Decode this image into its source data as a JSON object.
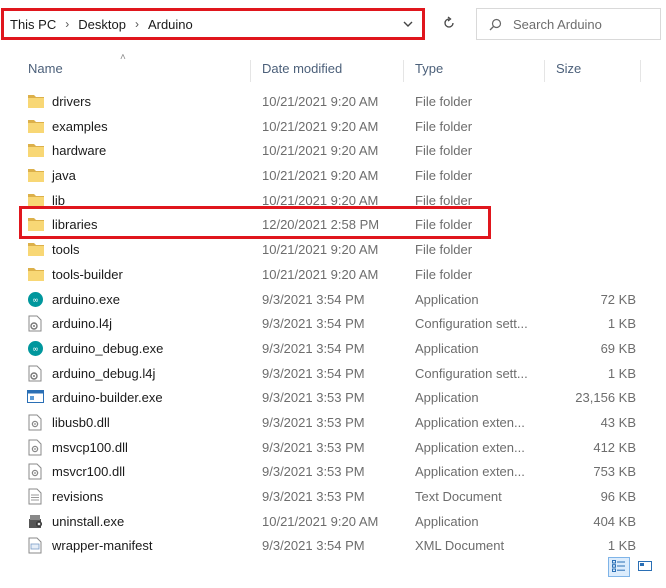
{
  "address": {
    "crumbs": [
      "This PC",
      "Desktop",
      "Arduino"
    ]
  },
  "search": {
    "placeholder": "Search Arduino"
  },
  "columns": {
    "name": "Name",
    "date": "Date modified",
    "type": "Type",
    "size": "Size"
  },
  "files": [
    {
      "name": "drivers",
      "date": "10/21/2021 9:20 AM",
      "type": "File folder",
      "size": "",
      "icon": "folder-icon"
    },
    {
      "name": "examples",
      "date": "10/21/2021 9:20 AM",
      "type": "File folder",
      "size": "",
      "icon": "folder-icon"
    },
    {
      "name": "hardware",
      "date": "10/21/2021 9:20 AM",
      "type": "File folder",
      "size": "",
      "icon": "folder-icon"
    },
    {
      "name": "java",
      "date": "10/21/2021 9:20 AM",
      "type": "File folder",
      "size": "",
      "icon": "folder-icon"
    },
    {
      "name": "lib",
      "date": "10/21/2021 9:20 AM",
      "type": "File folder",
      "size": "",
      "icon": "folder-icon"
    },
    {
      "name": "libraries",
      "date": "12/20/2021 2:58 PM",
      "type": "File folder",
      "size": "",
      "icon": "folder-icon"
    },
    {
      "name": "tools",
      "date": "10/21/2021 9:20 AM",
      "type": "File folder",
      "size": "",
      "icon": "folder-icon"
    },
    {
      "name": "tools-builder",
      "date": "10/21/2021 9:20 AM",
      "type": "File folder",
      "size": "",
      "icon": "folder-icon"
    },
    {
      "name": "arduino.exe",
      "date": "9/3/2021 3:54 PM",
      "type": "Application",
      "size": "72 KB",
      "icon": "arduino-icon"
    },
    {
      "name": "arduino.l4j",
      "date": "9/3/2021 3:54 PM",
      "type": "Configuration sett...",
      "size": "1 KB",
      "icon": "config-file-icon"
    },
    {
      "name": "arduino_debug.exe",
      "date": "9/3/2021 3:54 PM",
      "type": "Application",
      "size": "69 KB",
      "icon": "arduino-icon"
    },
    {
      "name": "arduino_debug.l4j",
      "date": "9/3/2021 3:54 PM",
      "type": "Configuration sett...",
      "size": "1 KB",
      "icon": "config-file-icon"
    },
    {
      "name": "arduino-builder.exe",
      "date": "9/3/2021 3:53 PM",
      "type": "Application",
      "size": "23,156 KB",
      "icon": "app-window-icon"
    },
    {
      "name": "libusb0.dll",
      "date": "9/3/2021 3:53 PM",
      "type": "Application exten...",
      "size": "43 KB",
      "icon": "dll-file-icon"
    },
    {
      "name": "msvcp100.dll",
      "date": "9/3/2021 3:53 PM",
      "type": "Application exten...",
      "size": "412 KB",
      "icon": "dll-file-icon"
    },
    {
      "name": "msvcr100.dll",
      "date": "9/3/2021 3:53 PM",
      "type": "Application exten...",
      "size": "753 KB",
      "icon": "dll-file-icon"
    },
    {
      "name": "revisions",
      "date": "9/3/2021 3:53 PM",
      "type": "Text Document",
      "size": "96 KB",
      "icon": "text-file-icon"
    },
    {
      "name": "uninstall.exe",
      "date": "10/21/2021 9:20 AM",
      "type": "Application",
      "size": "404 KB",
      "icon": "uninstall-icon"
    },
    {
      "name": "wrapper-manifest",
      "date": "9/3/2021 3:54 PM",
      "type": "XML Document",
      "size": "1 KB",
      "icon": "xml-file-icon"
    }
  ],
  "colors": {
    "highlight": "#e0161d",
    "folder": "#f8d775",
    "arduino": "#00979d"
  }
}
